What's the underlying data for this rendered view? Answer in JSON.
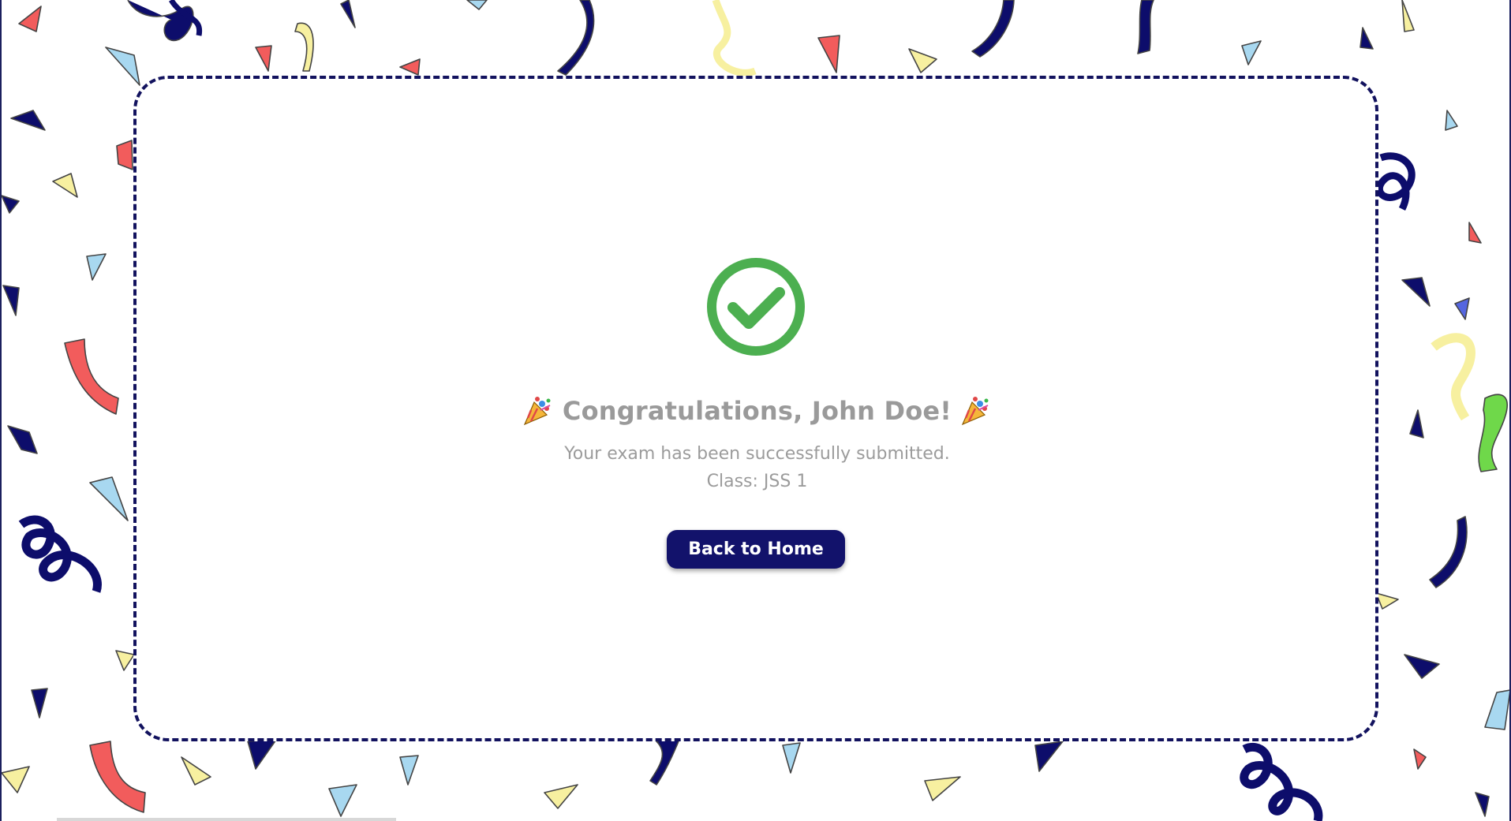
{
  "colors": {
    "card_border": "#12125e",
    "button_bg": "#12126b",
    "button_text": "#ffffff",
    "check_green": "#4caf50",
    "text_gray": "#9a9a9a",
    "confetti": [
      "#0d0d6b",
      "#f25c5c",
      "#f7f0a0",
      "#a8d8f0",
      "#6fd84a",
      "#5566e0"
    ]
  },
  "icons": {
    "success": "check-circle-icon",
    "party": "party-popper-icon"
  },
  "success": {
    "title": "Congratulations, John Doe!",
    "message": "Your exam has been successfully submitted.",
    "class_line": "Class: JSS 1"
  },
  "actions": {
    "back_home_label": "Back to Home"
  }
}
